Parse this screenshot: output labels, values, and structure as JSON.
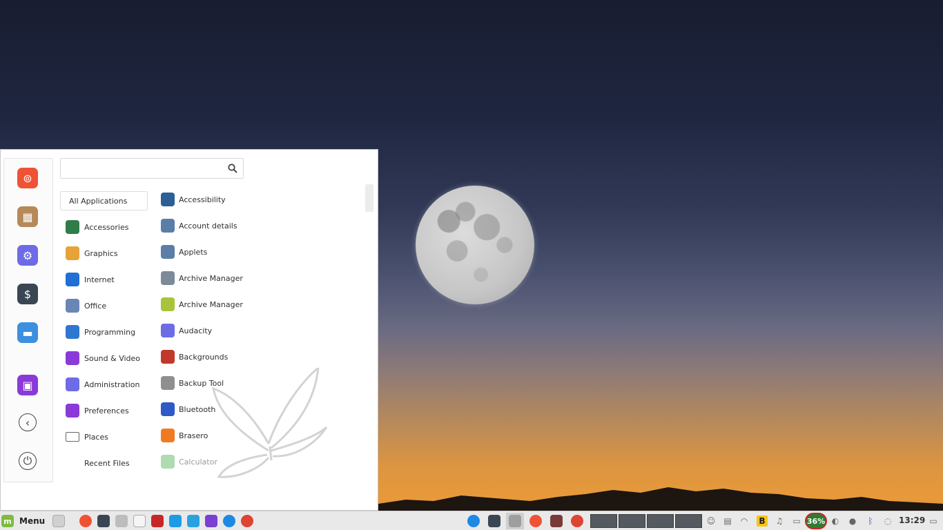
{
  "menu": {
    "search": {
      "value": "",
      "placeholder": ""
    },
    "favorites": [
      {
        "name": "firefox-icon",
        "color": "#ef5235"
      },
      {
        "name": "package-installer-icon",
        "color": "#b5895a"
      },
      {
        "name": "settings-icon",
        "color": "#6d6ce5"
      },
      {
        "name": "terminal-icon",
        "color": "#3a4652"
      },
      {
        "name": "files-icon",
        "color": "#3d8fe0"
      },
      {
        "name": "lock-screen-icon",
        "color": "#8a3ad8"
      },
      {
        "name": "logout-icon",
        "color": "#444444"
      },
      {
        "name": "shutdown-icon",
        "color": "#444444"
      }
    ],
    "categories": [
      {
        "label": "All Applications",
        "icon": "none",
        "color": "#ffffff"
      },
      {
        "label": "Accessories",
        "icon": "accessories-icon",
        "color": "#2f7d4a"
      },
      {
        "label": "Graphics",
        "icon": "graphics-icon",
        "color": "#e7a33a"
      },
      {
        "label": "Internet",
        "icon": "internet-icon",
        "color": "#1f6fd6"
      },
      {
        "label": "Office",
        "icon": "office-icon",
        "color": "#6a86b5"
      },
      {
        "label": "Programming",
        "icon": "programming-icon",
        "color": "#2f77d1"
      },
      {
        "label": "Sound & Video",
        "icon": "sound-video-icon",
        "color": "#8a3ad8"
      },
      {
        "label": "Administration",
        "icon": "administration-icon",
        "color": "#6d6ce5"
      },
      {
        "label": "Preferences",
        "icon": "preferences-icon",
        "color": "#8a3ad8"
      },
      {
        "label": "Places",
        "icon": "folder-icon",
        "color": "#ffffff"
      },
      {
        "label": "Recent Files",
        "icon": "none",
        "color": "#ffffff"
      }
    ],
    "apps": [
      {
        "label": "Accessibility",
        "icon": "accessibility-icon",
        "color": "#2c5f96"
      },
      {
        "label": "Account details",
        "icon": "account-icon",
        "color": "#5a7ea8"
      },
      {
        "label": "Applets",
        "icon": "applets-icon",
        "color": "#5a7ea8"
      },
      {
        "label": "Archive Manager",
        "icon": "archive-manager-icon",
        "color": "#7c8a99"
      },
      {
        "label": "Archive Manager",
        "icon": "archive-manager-alt-icon",
        "color": "#a8c43a"
      },
      {
        "label": "Audacity",
        "icon": "audacity-icon",
        "color": "#6d6ce5"
      },
      {
        "label": "Backgrounds",
        "icon": "backgrounds-icon",
        "color": "#c0392b"
      },
      {
        "label": "Backup Tool",
        "icon": "backup-tool-icon",
        "color": "#8f8f8f"
      },
      {
        "label": "Bluetooth",
        "icon": "bluetooth-icon",
        "color": "#2f58c8"
      },
      {
        "label": "Brasero",
        "icon": "brasero-icon",
        "color": "#f07a22"
      },
      {
        "label": "Calculator",
        "icon": "calculator-icon",
        "color": "#4caf50"
      }
    ]
  },
  "taskbar": {
    "menu_label": "Menu",
    "launchers": [
      {
        "name": "show-desktop-icon",
        "color": "#d0d0d0"
      },
      {
        "name": "firefox-icon",
        "color": "#ef5235"
      },
      {
        "name": "terminal-icon",
        "color": "#3a4652"
      },
      {
        "name": "files-icon",
        "color": "#bdbdbd"
      },
      {
        "name": "text-editor-icon",
        "color": "#f5f5f5"
      },
      {
        "name": "network-tool-icon",
        "color": "#c62828"
      },
      {
        "name": "notes-icon",
        "color": "#1e9be6"
      },
      {
        "name": "sync-icon",
        "color": "#29a3e0"
      },
      {
        "name": "cube-icon",
        "color": "#7b3fd1"
      },
      {
        "name": "skype-icon",
        "color": "#1e88e5"
      },
      {
        "name": "chrome-icon",
        "color": "#dd4433"
      }
    ],
    "windows": [
      {
        "name": "window-network-icon",
        "color": "#1e88e5"
      },
      {
        "name": "window-terminal-icon",
        "color": "#3a4652"
      },
      {
        "name": "window-files-icon",
        "color": "#9e9e9e"
      },
      {
        "name": "window-firefox-icon",
        "color": "#ef5235"
      },
      {
        "name": "window-app-icon",
        "color": "#7a3a3a"
      },
      {
        "name": "window-chrome-icon",
        "color": "#dd4433"
      }
    ],
    "battery_percent": "36%",
    "clock": "13:29"
  }
}
